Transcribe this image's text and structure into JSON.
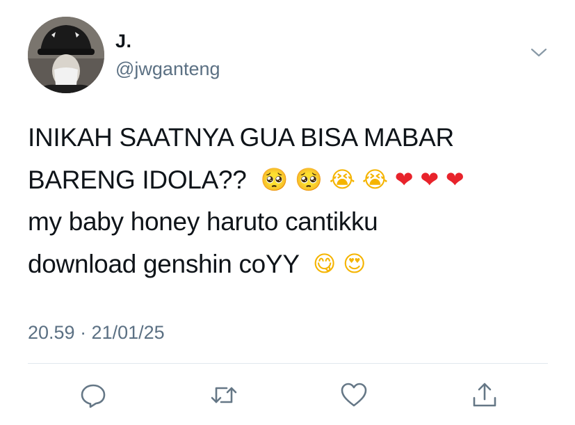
{
  "author": {
    "display_name": "J.",
    "handle": "@jwganteng"
  },
  "tweet": {
    "lines": [
      {
        "text": "INIKAH SAATNYA GUA BISA MABAR",
        "emojis": []
      },
      {
        "text": "BARENG IDOLA??",
        "emojis": [
          "🥺",
          "🥺",
          "😭",
          "😭",
          "❤",
          "❤",
          "❤"
        ]
      },
      {
        "text": "my baby honey haruto cantikku",
        "emojis": []
      },
      {
        "text": "download genshin coYY",
        "emojis": [
          "😋",
          "😍"
        ]
      }
    ],
    "timestamp": "20.59 · 21/01/25"
  },
  "actions": [
    {
      "name": "reply-button",
      "icon": "reply-icon"
    },
    {
      "name": "retweet-button",
      "icon": "retweet-icon"
    },
    {
      "name": "like-button",
      "icon": "heart-icon"
    },
    {
      "name": "share-button",
      "icon": "share-icon"
    }
  ],
  "colors": {
    "text": "#0f1419",
    "secondary": "#5b7083",
    "icon": "#657786",
    "divider": "#e1e8ed",
    "heart": "#e8232b"
  }
}
